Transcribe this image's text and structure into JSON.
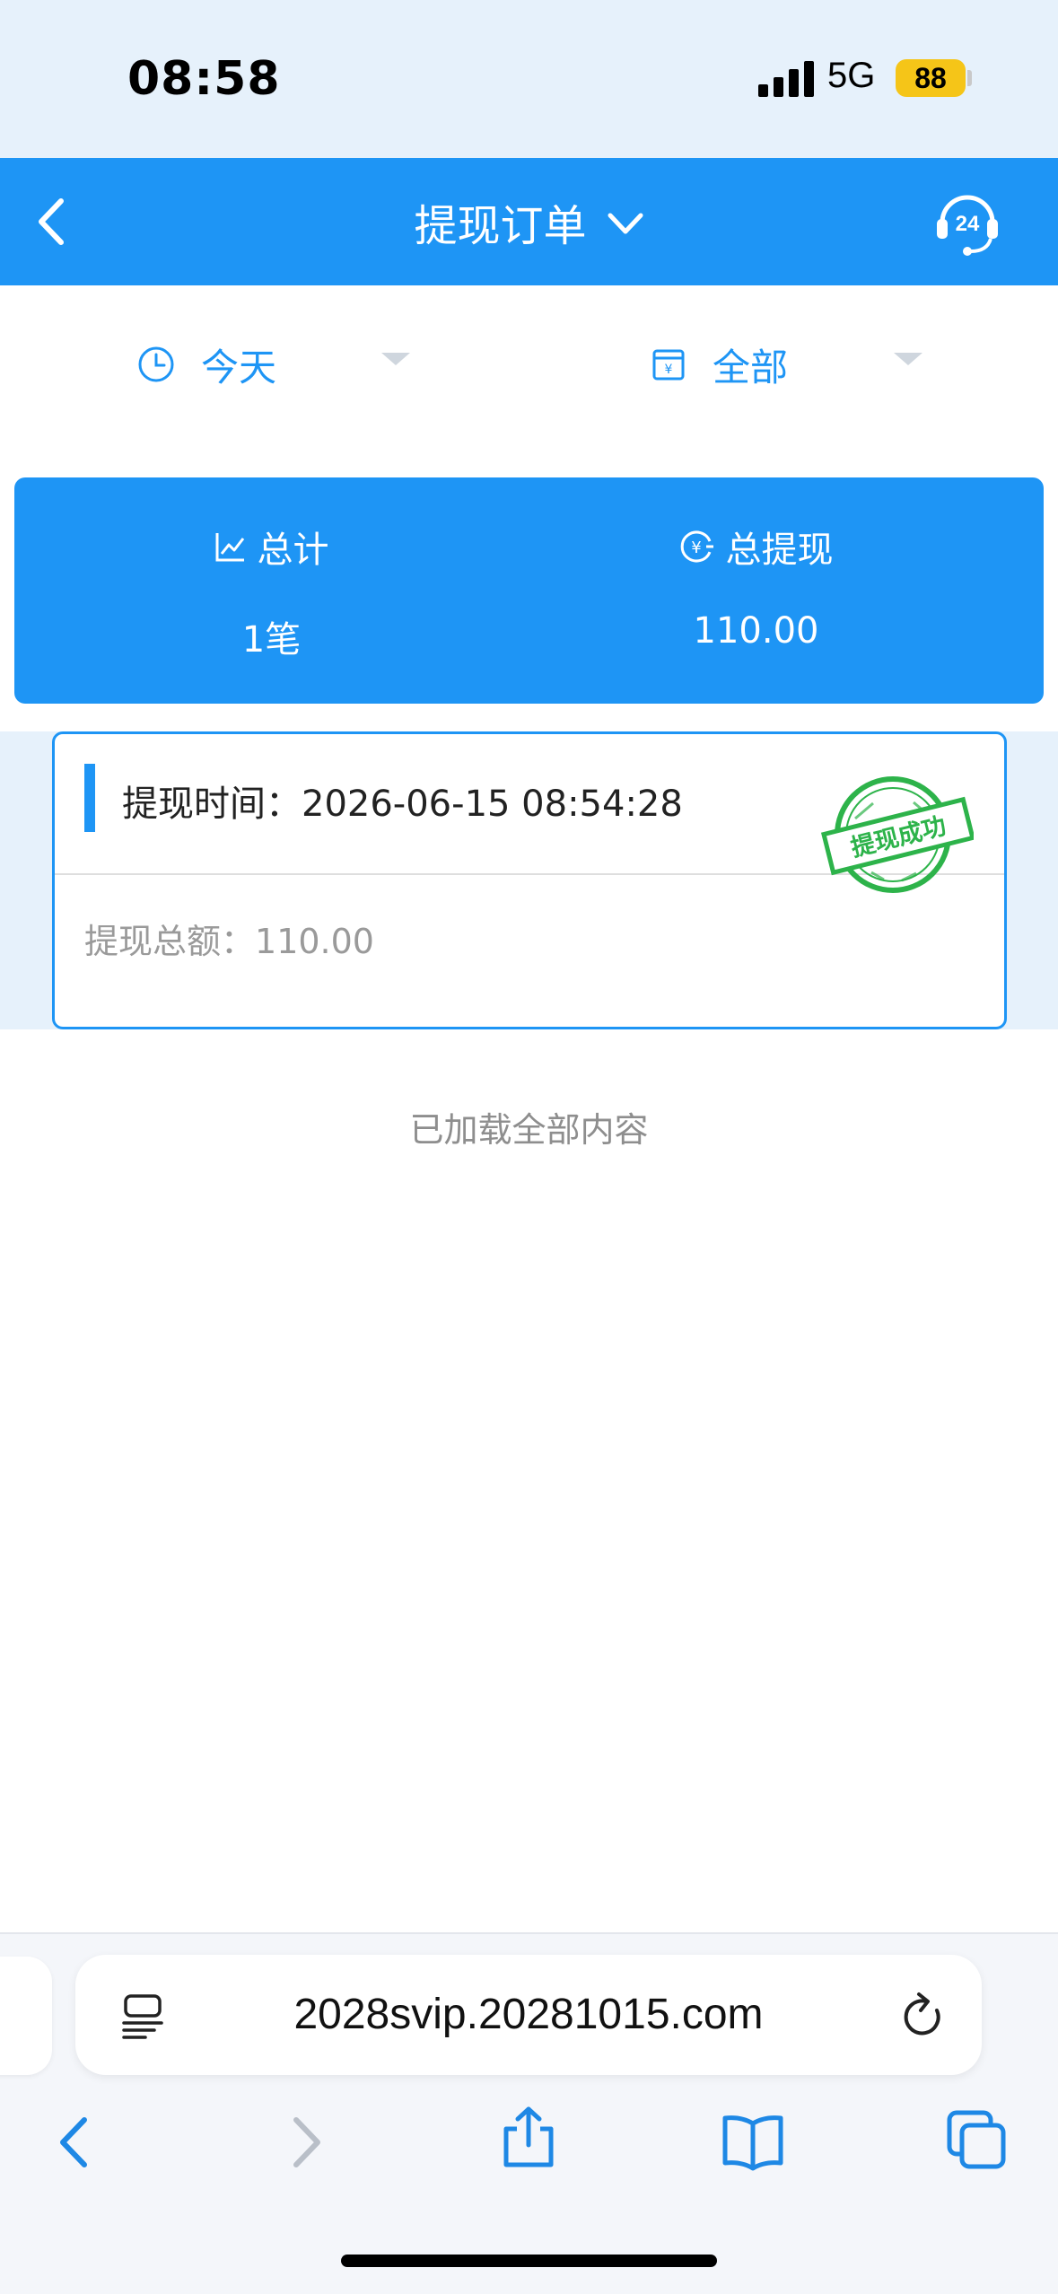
{
  "status_bar": {
    "time": "08:58",
    "network": "5G",
    "battery": "88"
  },
  "header": {
    "title": "提现订单",
    "back_icon": "chevron-left-icon",
    "support_icon": "headset-24-icon",
    "support_badge": "24"
  },
  "filters": {
    "date": {
      "label": "今天",
      "icon": "clock-icon"
    },
    "type": {
      "label": "全部",
      "icon": "calendar-icon"
    }
  },
  "summary": {
    "count_label": "总计",
    "count_value": "1笔",
    "total_label": "总提现",
    "total_value": "110.00"
  },
  "orders": [
    {
      "time_label": "提现时间：",
      "time_value": "2026-06-15 08:54:28",
      "amount_label": "提现总额：",
      "amount_value": "110.00",
      "stamp_text": "提现成功"
    }
  ],
  "list_footer": "已加载全部内容",
  "browser": {
    "url": "2028svip.20281015.com",
    "toolbar": [
      "back-icon",
      "forward-icon",
      "share-icon",
      "bookmarks-icon",
      "tabs-icon"
    ]
  },
  "colors": {
    "primary": "#1e95f5",
    "stamp": "#2db34a",
    "band": "#e6f1fb"
  }
}
